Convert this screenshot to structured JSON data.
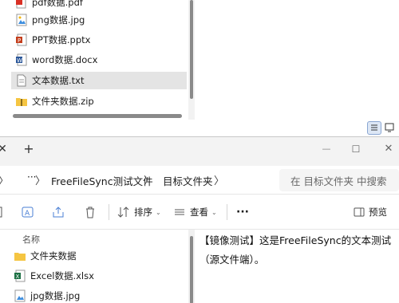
{
  "top_window": {
    "files": [
      {
        "name": "pdf数据.pdf",
        "icon": "pdf-icon"
      },
      {
        "name": "png数据.jpg",
        "icon": "image-file-icon"
      },
      {
        "name": "PPT数据.pptx",
        "icon": "ppt-file-icon"
      },
      {
        "name": "word数据.docx",
        "icon": "word-file-icon"
      },
      {
        "name": "文本数据.txt",
        "icon": "text-file-icon",
        "selected": true
      },
      {
        "name": "文件夹数据.zip",
        "icon": "zip-folder-icon"
      }
    ]
  },
  "front_window": {
    "titlebar": {
      "close_tab": "✕",
      "new_tab": "+",
      "minimize": "—",
      "maximize": "☐",
      "close": "✕"
    },
    "nav": {
      "more": "···",
      "crumbs": [
        "FreeFileSync测试文件",
        "目标文件夹"
      ],
      "search_placeholder": "在 目标文件夹 中搜索"
    },
    "toolbar": {
      "sort_label": "排序",
      "view_label": "查看",
      "more": "···",
      "preview_label": "预览"
    },
    "column_header": "名称",
    "files": [
      {
        "name": "文件夹数据",
        "icon": "folder-icon"
      },
      {
        "name": "Excel数据.xlsx",
        "icon": "excel-file-icon"
      },
      {
        "name": "jpg数据.jpg",
        "icon": "image-file-icon"
      }
    ],
    "preview": {
      "line1": "【镜像测试】这是FreeFileSync的文本测试",
      "line2": "（源文件端）。"
    }
  },
  "colors": {
    "accent": "#0067c0",
    "selected_row": "#e4e4e4",
    "folder": "#f5c542",
    "pdf": "#d93025",
    "excel": "#1e7145",
    "word": "#2b579a",
    "ppt": "#c43e1c"
  }
}
